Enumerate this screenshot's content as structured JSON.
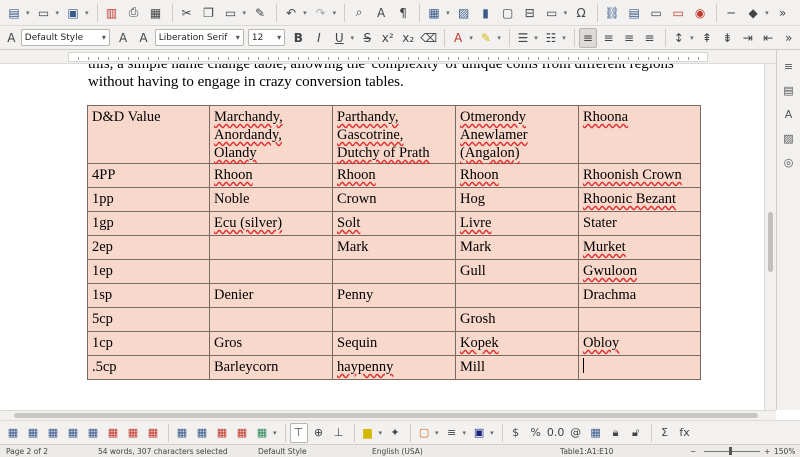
{
  "toolbar": {
    "style_name": "Default Style",
    "font_name": "Liberation Serif",
    "font_size": "12",
    "bold_label": "B",
    "italic_label": "I",
    "underline_label": "U",
    "strike_label": "S",
    "omega_label": "Ω"
  },
  "document": {
    "intro_line1": "this, a simple name change table, allowing the 'complexity' of unique coins from different regions",
    "intro_line2": "without having to engage in crazy conversion tables.",
    "table": {
      "headers": [
        "D&D Value",
        "Marchandy,\nAnordandy,\nOlandy",
        "Parthandy,\nGascotrine,\nDutchy of Prath",
        "Otmerondy\nAnewlamer\n(Angalon)",
        "Rhoona"
      ],
      "rows": [
        [
          "4PP",
          "Rhoon",
          "Rhoon",
          "Rhoon",
          "Rhoonish Crown"
        ],
        [
          "1pp",
          "Noble",
          "Crown",
          "Hog",
          "Rhoonic Bezant"
        ],
        [
          "1gp",
          "Ecu (silver)",
          "Solt",
          "Livre",
          "Stater"
        ],
        [
          "2ep",
          "",
          "Mark",
          "Mark",
          "Murket"
        ],
        [
          "1ep",
          "",
          "",
          "Gull",
          "Gwuloon"
        ],
        [
          "1sp",
          "Denier",
          "Penny",
          "",
          "Drachma"
        ],
        [
          "5cp",
          "",
          "",
          "Grosh",
          ""
        ],
        [
          "1cp",
          "Gros",
          "Sequin",
          "Kopek",
          "Obloy"
        ],
        [
          ".5cp",
          "Barleycorn",
          "haypenny",
          "Mill",
          ""
        ]
      ]
    }
  },
  "statusbar": {
    "page": "Page 2 of 2",
    "words": "54 words, 307 characters selected",
    "page_style": "Default Style",
    "language": "English (USA)",
    "table_cell": "Table1:A1:E10",
    "zoom": "150%"
  }
}
